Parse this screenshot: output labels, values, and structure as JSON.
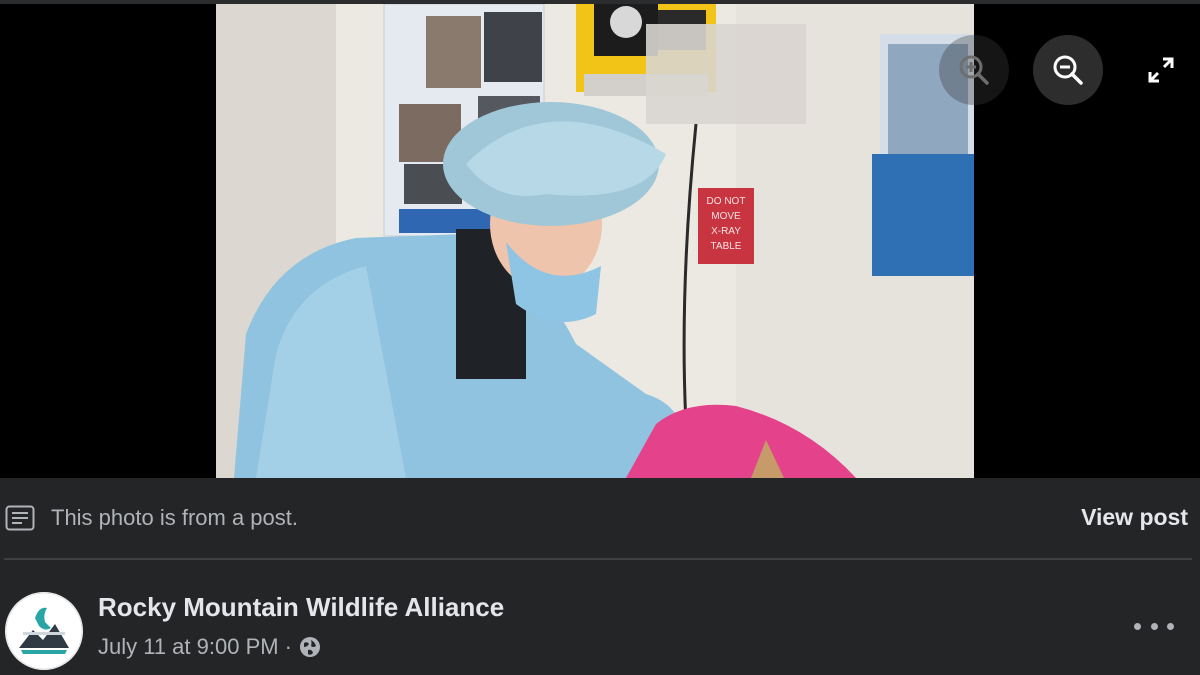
{
  "viewer": {
    "photo_alt": "",
    "photo_sign_text": [
      "DO NOT",
      "MOVE",
      "X-RAY",
      "TABLE"
    ],
    "controls": {
      "zoom_in_icon": "zoom-in-icon",
      "zoom_out_icon": "zoom-out-icon",
      "fullscreen_icon": "fullscreen-icon"
    }
  },
  "notice": {
    "icon": "post-note-icon",
    "text": "This photo is from a post.",
    "view_post_label": "View post"
  },
  "post": {
    "page_name": "Rocky Mountain Wildlife Alliance",
    "timestamp": "July 11 at 9:00 PM",
    "separator": "·",
    "audience_icon": "globe-icon",
    "more_icon": "more-options-icon"
  },
  "colors": {
    "bar_background": "#242526",
    "primary_text": "#e4e6eb",
    "secondary_text": "#b0b3b8",
    "divider": "#3e4042"
  }
}
